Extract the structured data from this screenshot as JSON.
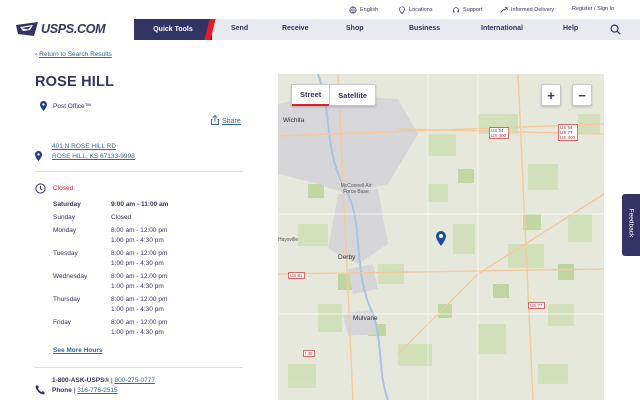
{
  "utility": {
    "english": "English",
    "locations": "Locations",
    "support": "Support",
    "informed_delivery": "Informed Delivery",
    "register": "Register / Sign In"
  },
  "logo": {
    "text": "USPS.COM"
  },
  "nav": {
    "quick_tools": "Quick Tools",
    "items": [
      "Send",
      "Receive",
      "Shop",
      "Business",
      "International",
      "Help"
    ]
  },
  "back_link": "Return to Search Results",
  "office": {
    "name": "ROSE HILL",
    "type": "Post Office™",
    "share": "Share",
    "address_line1": "401 N ROSE HILL RD",
    "address_line2": "ROSE HILL, KS 67133-9998",
    "status": "Closed"
  },
  "hours": [
    {
      "day": "Saturday",
      "lines": [
        "9:00 am - 11:00 am"
      ]
    },
    {
      "day": "Sunday",
      "lines": [
        "Closed"
      ]
    },
    {
      "day": "Monday",
      "lines": [
        "8:00 am - 12:00 pm",
        "1:00 pm - 4:30 pm"
      ]
    },
    {
      "day": "Tuesday",
      "lines": [
        "8:00 am - 12:00 pm",
        "1:00 pm - 4:30 pm"
      ]
    },
    {
      "day": "Wednesday",
      "lines": [
        "8:00 am - 12:00 pm",
        "1:00 pm - 4:30 pm"
      ]
    },
    {
      "day": "Thursday",
      "lines": [
        "8:00 am - 12:00 pm",
        "1:00 pm - 4:30 pm"
      ]
    },
    {
      "day": "Friday",
      "lines": [
        "8:00 am - 12:00 pm",
        "1:00 pm - 4:30 pm"
      ]
    }
  ],
  "see_more_hours": "See More Hours",
  "phone": {
    "ask_label": "1-800-ASK-USPS®",
    "ask_sep": " | ",
    "ask_number": "800-275-0777",
    "phone_label": "Phone",
    "phone_number": "316-776-2515"
  },
  "map": {
    "street": "Street",
    "satellite": "Satellite",
    "zoom_in": "+",
    "zoom_out": "−",
    "cities": {
      "wichita": "Wichita",
      "derby": "Derby",
      "mulvane": "Mulvane",
      "haysville": "Haysville"
    },
    "base_label": "McConnell Air Force Base",
    "shields": {
      "us54_400": "US 54 US 400",
      "us54_77_400": "US 54 US 77 US 400",
      "us81": "US 81",
      "us77": "US 77",
      "i35": "I 35"
    }
  },
  "feedback": "Feedback",
  "colors": {
    "navy": "#333366",
    "red": "#e71921",
    "link": "#336699"
  }
}
